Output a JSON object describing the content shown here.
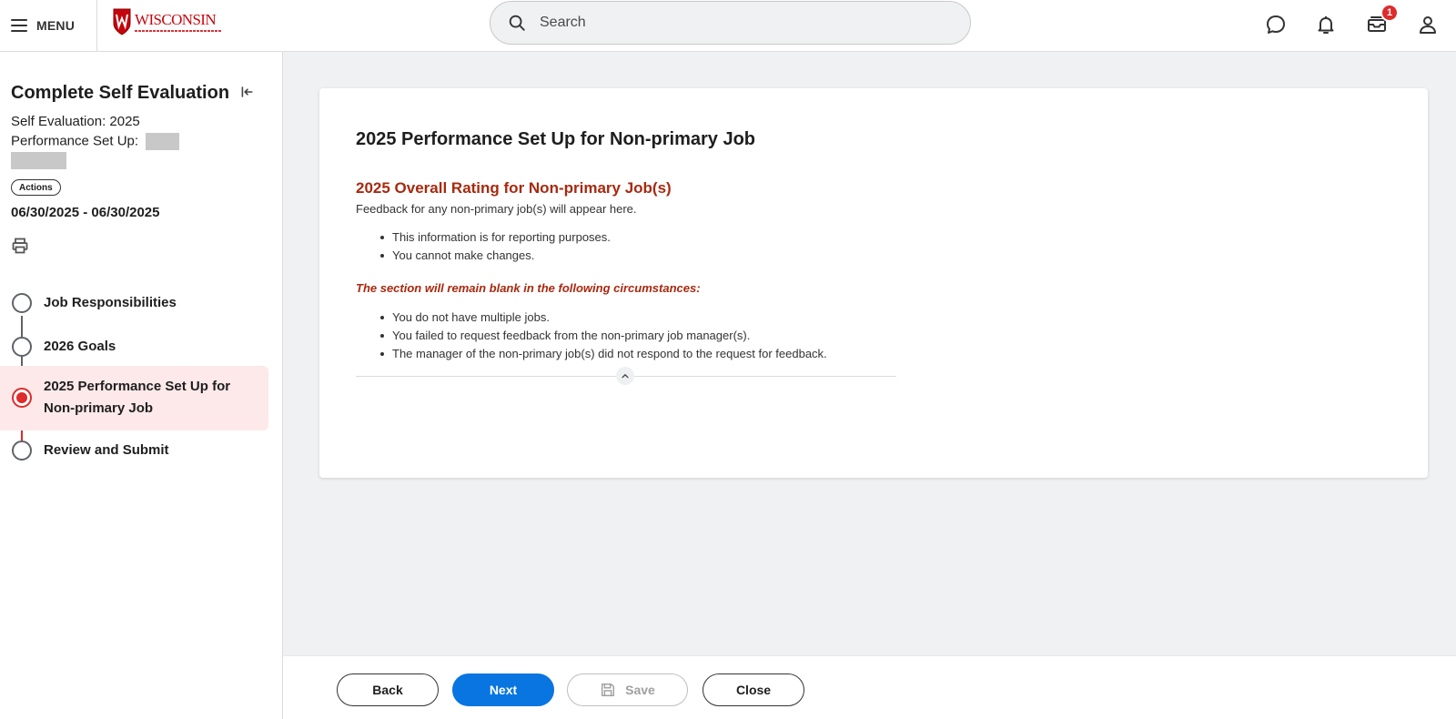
{
  "header": {
    "menu_label": "MENU",
    "logo_text": "WISCONSIN",
    "search_placeholder": "Search",
    "inbox_badge": "1"
  },
  "sidebar": {
    "title": "Complete Self Evaluation",
    "self_evaluation": "Self Evaluation: 2025",
    "performance_setup": "Performance Set Up:",
    "actions_label": "Actions",
    "date_range": "06/30/2025 - 06/30/2025",
    "steps": [
      {
        "label": "Job Responsibilities",
        "status": "incomplete"
      },
      {
        "label": "2026 Goals",
        "status": "incomplete"
      },
      {
        "label": "2025 Performance Set Up for Non-primary Job",
        "status": "current"
      },
      {
        "label": "Review and Submit",
        "status": "incomplete"
      }
    ]
  },
  "main": {
    "title": "2025 Performance Set Up for Non-primary Job",
    "section_heading": "2025 Overall Rating for Non-primary Job(s)",
    "feedback_note": "Feedback for any non-primary job(s) will appear here.",
    "info_bullets": [
      "This information is for reporting purposes.",
      "You cannot make changes."
    ],
    "warning": "The section will remain blank in the following circumstances:",
    "circumstance_bullets": [
      "You do not have multiple jobs.",
      "You failed to request feedback from the non-primary job manager(s).",
      "The manager of the non-primary job(s) did not respond to the request for feedback."
    ]
  },
  "footer": {
    "back_label": "Back",
    "next_label": "Next",
    "save_label": "Save",
    "close_label": "Close"
  },
  "colors": {
    "accent_blue": "#0875e1",
    "brand_red": "#c5050c",
    "heading_red": "#a8290f",
    "step_active": "#de2b2b",
    "step_active_bg": "#fde9ea"
  },
  "icons": [
    "menu-icon",
    "search-icon",
    "chat-icon",
    "bell-icon",
    "inbox-icon",
    "user-icon",
    "collapse-panel-icon",
    "print-icon",
    "chevron-up-icon",
    "save-icon"
  ]
}
